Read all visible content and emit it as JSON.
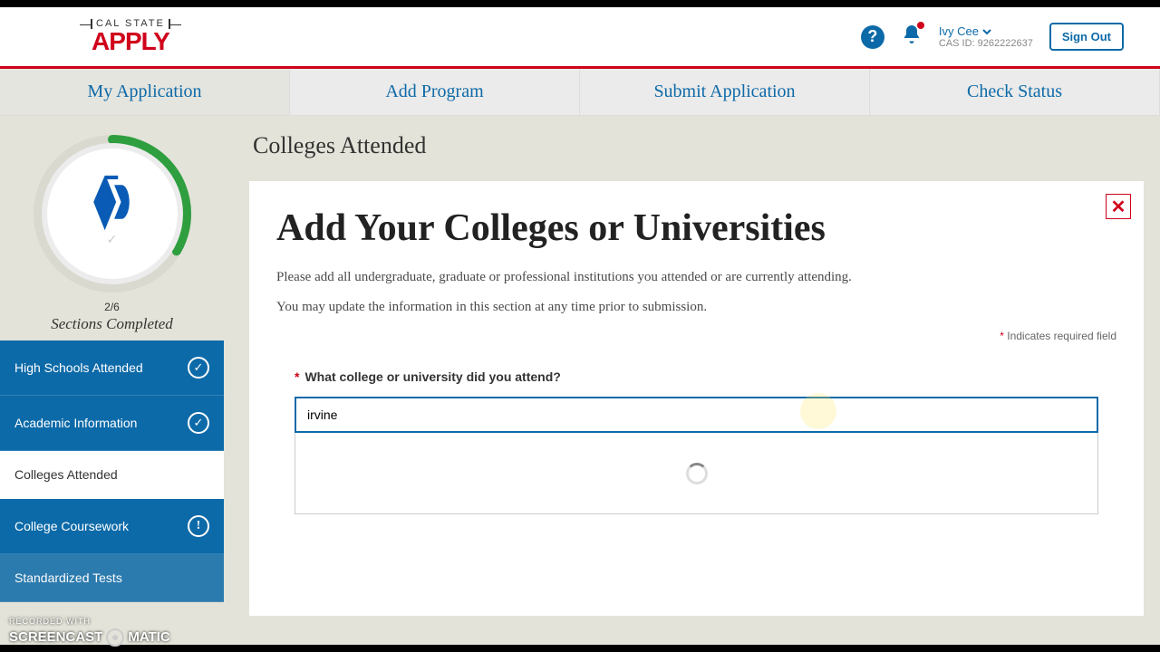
{
  "logo": {
    "top": "CAL STATE",
    "bottom": "APPLY"
  },
  "header": {
    "user_name": "Ivy Cee",
    "cas_id_label": "CAS ID: 9262222637",
    "signout": "Sign Out"
  },
  "nav": {
    "my_app": "My Application",
    "add_program": "Add Program",
    "submit": "Submit Application",
    "check_status": "Check Status"
  },
  "sidebar": {
    "progress_count": "2/6",
    "progress_label": "Sections Completed",
    "items": [
      {
        "label": "High Schools Attended",
        "status": "done"
      },
      {
        "label": "Academic Information",
        "status": "done"
      },
      {
        "label": "Colleges Attended",
        "status": "current"
      },
      {
        "label": "College Coursework",
        "status": "alert"
      },
      {
        "label": "Standardized Tests",
        "status": "pending"
      }
    ]
  },
  "main": {
    "page_title": "Colleges Attended",
    "heading": "Add Your Colleges or Universities",
    "intro1": "Please add all undergraduate, graduate or professional institutions you attended or are currently attending.",
    "intro2": "You may update the information in this section at any time prior to submission.",
    "required_note": "Indicates required field",
    "question": "What college or university did you attend?",
    "input_value": "irvine"
  },
  "watermark": {
    "line1": "RECORDED WITH",
    "line2a": "SCREENCAST",
    "line2b": "MATIC"
  }
}
